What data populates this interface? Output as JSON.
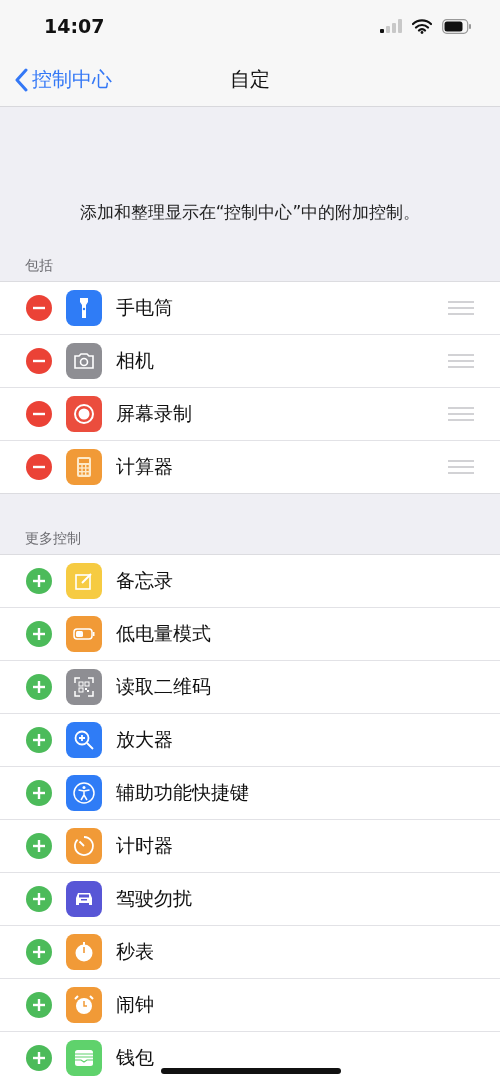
{
  "status_bar": {
    "time": "14:07"
  },
  "nav": {
    "back": "控制中心",
    "title": "自定"
  },
  "description": "添加和整理显示在“控制中心”中的附加控制。",
  "sections": [
    {
      "header": "包括",
      "kind": "remove",
      "items": [
        {
          "label": "手电筒",
          "kind": "flashlight",
          "color": "#2f7cf6"
        },
        {
          "label": "相机",
          "kind": "camera",
          "color": "#8e8e93"
        },
        {
          "label": "屏幕录制",
          "kind": "record",
          "color": "#eb4d3d"
        },
        {
          "label": "计算器",
          "kind": "calculator",
          "color": "#f19a37"
        }
      ]
    },
    {
      "header": "更多控制",
      "kind": "add",
      "items": [
        {
          "label": "备忘录",
          "kind": "notes",
          "color": "#f6cb42"
        },
        {
          "label": "低电量模式",
          "kind": "battery",
          "color": "#f19a37"
        },
        {
          "label": "读取二维码",
          "kind": "qr",
          "color": "#8e8e93"
        },
        {
          "label": "放大器",
          "kind": "magnifier",
          "color": "#2f7cf6"
        },
        {
          "label": "辅助功能快捷键",
          "kind": "accessibility",
          "color": "#2f7cf6"
        },
        {
          "label": "计时器",
          "kind": "timer",
          "color": "#f19a37"
        },
        {
          "label": "驾驶勿扰",
          "kind": "car",
          "color": "#5856d6"
        },
        {
          "label": "秒表",
          "kind": "stopwatch",
          "color": "#f19a37"
        },
        {
          "label": "闹钟",
          "kind": "alarm",
          "color": "#f19a37"
        },
        {
          "label": "钱包",
          "kind": "wallet",
          "color": "#5fd26c"
        }
      ]
    }
  ]
}
